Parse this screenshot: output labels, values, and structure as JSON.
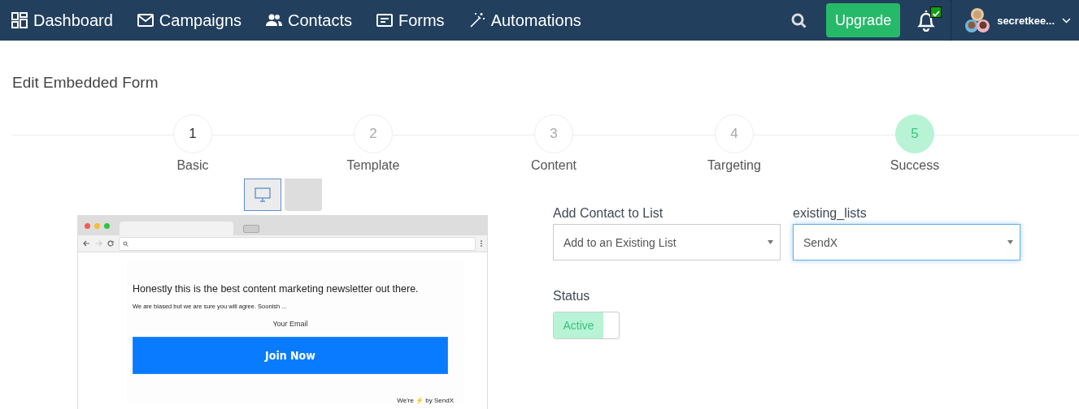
{
  "nav": {
    "items": [
      {
        "label": "Dashboard",
        "kind": "dashboard"
      },
      {
        "label": "Campaigns",
        "kind": "mail"
      },
      {
        "label": "Contacts",
        "kind": "people"
      },
      {
        "label": "Forms",
        "kind": "form"
      },
      {
        "label": "Automations",
        "kind": "wand"
      }
    ],
    "upgrade": "Upgrade",
    "notification_badge": true,
    "username": "secretkee..."
  },
  "page_title": "Edit Embedded Form",
  "steps": [
    {
      "number": "1",
      "label": "Basic",
      "completed": true,
      "selected": false
    },
    {
      "number": "2",
      "label": "Template",
      "completed": false,
      "selected": false
    },
    {
      "number": "3",
      "label": "Content",
      "completed": false,
      "selected": false
    },
    {
      "number": "4",
      "label": "Targeting",
      "completed": false,
      "selected": false
    },
    {
      "number": "5",
      "label": "Success",
      "completed": false,
      "selected": true
    }
  ],
  "device_toggles": [
    {
      "kind": "desktop",
      "selected": true
    },
    {
      "kind": "mobile",
      "selected": false
    }
  ],
  "preview": {
    "headline": "Honestly this is the best content marketing newsletter out there.",
    "subtext": "We are biased but we are sure you will agree. Soonish ...",
    "email_placeholder": "Your Email",
    "button": "Join Now",
    "footer": "We're ⚡ by SendX"
  },
  "settings": {
    "fields": [
      {
        "label": "Add Contact to List",
        "value": "Add to an Existing List",
        "focused": false
      },
      {
        "label": "existing_lists",
        "value": "SendX",
        "focused": true
      }
    ],
    "status": {
      "label": "Status",
      "toggle_label": "Active",
      "on": true
    }
  }
}
